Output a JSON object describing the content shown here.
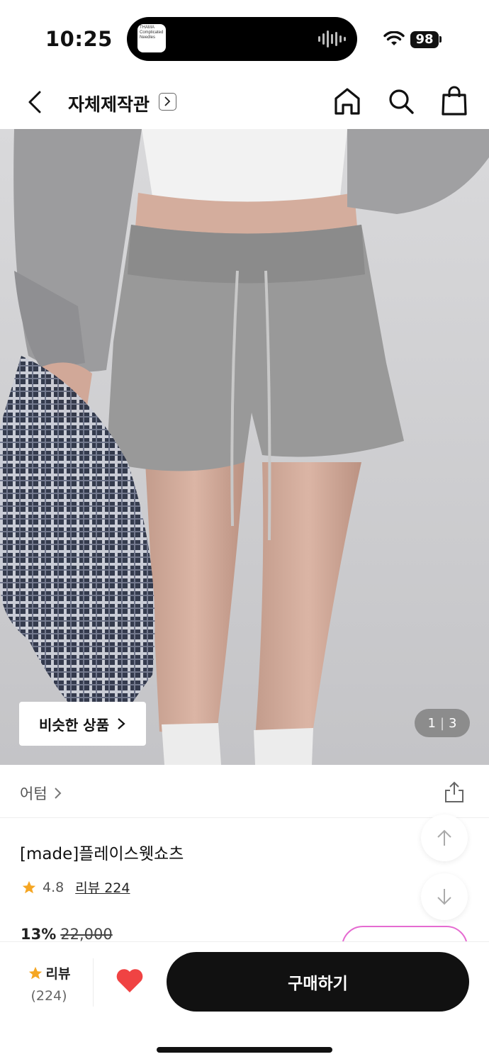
{
  "status_bar": {
    "time": "10:25",
    "battery": "98",
    "now_playing_thumb_text": "THAMA\nComplicated\nNeedles"
  },
  "nav": {
    "title": "자체제작관",
    "icons": [
      "back-chevron-icon",
      "chevron-right-icon",
      "home-icon",
      "search-icon",
      "shopping-bag-icon"
    ]
  },
  "hero": {
    "similar_button_label": "비슷한 상품",
    "page_current": "1",
    "page_total": "3"
  },
  "product": {
    "brand": "어텀",
    "name": "[made]플레이스웻쇼츠",
    "rating": "4.8",
    "review_label": "리뷰 224",
    "discount": "13%",
    "original_price": "22,000"
  },
  "bottom_bar": {
    "review_label": "리뷰",
    "review_count": "(224)",
    "buy_label": "구매하기",
    "heart_color": "#f04343",
    "star_color": "#f5a623"
  }
}
